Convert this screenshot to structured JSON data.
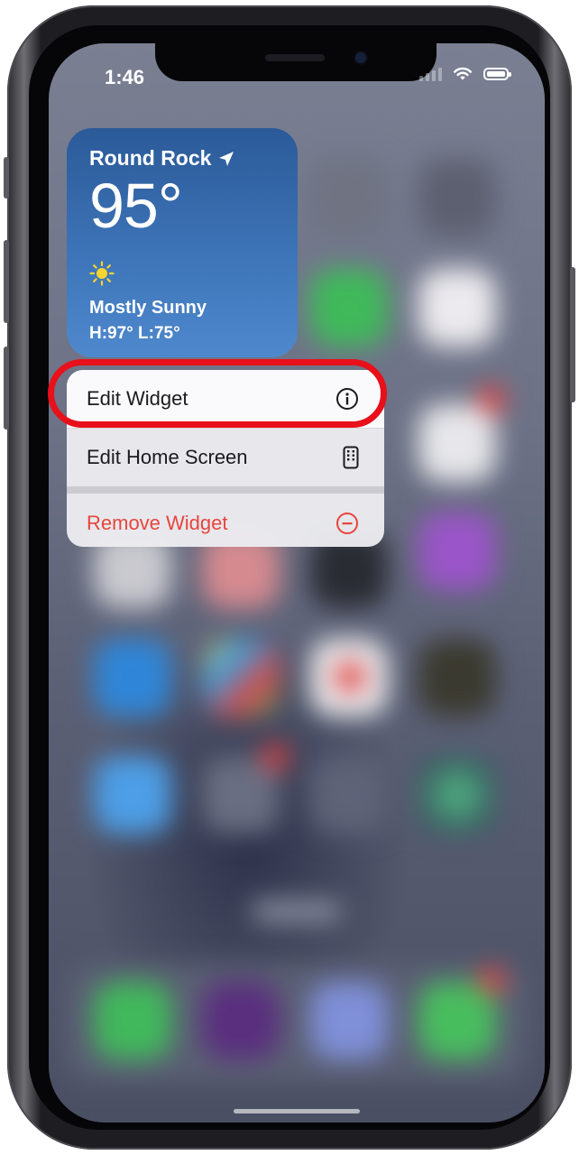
{
  "status_bar": {
    "time": "1:46",
    "icons": [
      "cellular-signal-icon",
      "wifi-icon",
      "battery-icon"
    ],
    "battery_level": 1.0
  },
  "weather_widget": {
    "city": "Round Rock",
    "temperature": "95°",
    "condition": "Mostly Sunny",
    "high_low": "H:97° L:75°",
    "icons": [
      "location-arrow-icon",
      "sun-icon"
    ]
  },
  "context_menu": {
    "items": [
      {
        "label": "Edit Widget",
        "icon": "info-circle-icon",
        "highlighted": true
      },
      {
        "label": "Edit Home Screen",
        "icon": "phone-apps-icon"
      },
      {
        "label": "Remove Widget",
        "icon": "minus-circle-icon",
        "destructive": true
      }
    ]
  },
  "colors": {
    "highlight_ring": "#e8101a",
    "destructive": "#e8453c",
    "widget_top": "#2b5a98",
    "widget_bottom": "#4f89cd"
  }
}
